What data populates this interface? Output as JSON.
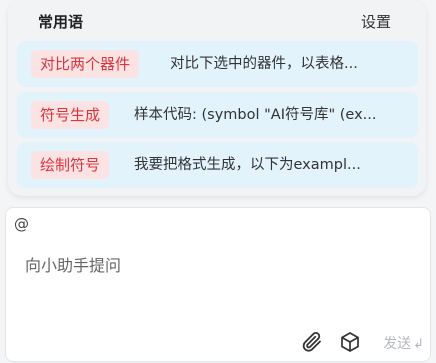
{
  "popup": {
    "title": "常用语",
    "settings_label": "设置",
    "items": [
      {
        "tag": "对比两个器件",
        "desc": "对比下选中的器件，以表格..."
      },
      {
        "tag": "符号生成",
        "desc": "样本代码: (symbol \"AI符号库\" (ex..."
      },
      {
        "tag": "绘制符号",
        "desc": "我要把格式生成，以下为exampl..."
      }
    ]
  },
  "input": {
    "mention_symbol": "@",
    "placeholder": "向小助手提问",
    "send_label": "发送",
    "send_enter_glyph": "↲"
  },
  "icons": {
    "attach": "paperclip-icon",
    "component": "cube-icon"
  },
  "colors": {
    "tag_bg": "#fbe3e4",
    "tag_text": "#d9363e",
    "item_bg": "#e2f3fc",
    "send_disabled": "#b5b8bd"
  }
}
